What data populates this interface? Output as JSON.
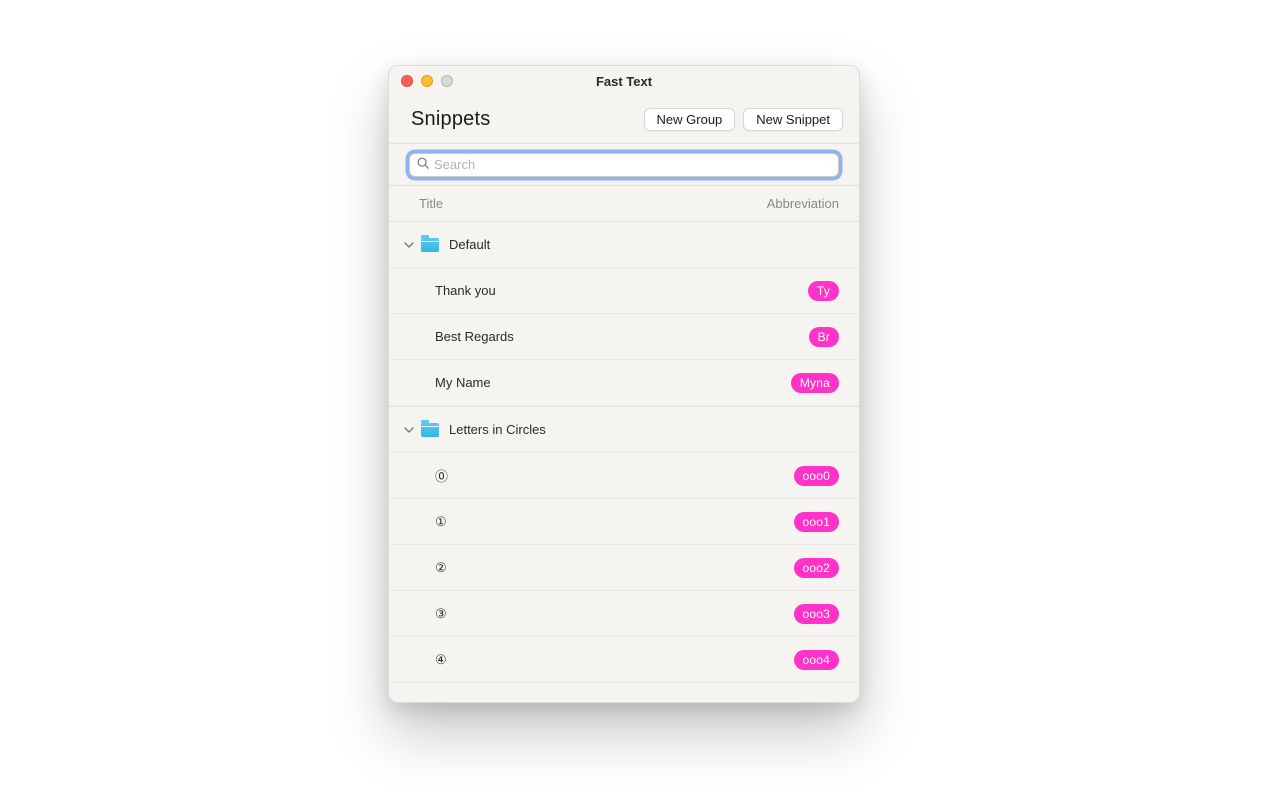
{
  "window": {
    "title": "Fast Text"
  },
  "toolbar": {
    "heading": "Snippets",
    "new_group_label": "New Group",
    "new_snippet_label": "New Snippet"
  },
  "search": {
    "placeholder": "Search"
  },
  "columns": {
    "title": "Title",
    "abbreviation": "Abbreviation"
  },
  "groups": [
    {
      "name": "Default",
      "items": [
        {
          "title": "Thank you",
          "abbr": "Ty"
        },
        {
          "title": "Best Regards",
          "abbr": "Br"
        },
        {
          "title": "My Name",
          "abbr": "Myna"
        }
      ]
    },
    {
      "name": "Letters in Circles",
      "items": [
        {
          "title": "⓪",
          "abbr": "ooo0"
        },
        {
          "title": "①",
          "abbr": "ooo1"
        },
        {
          "title": "②",
          "abbr": "ooo2"
        },
        {
          "title": "③",
          "abbr": "ooo3"
        },
        {
          "title": "④",
          "abbr": "ooo4"
        }
      ]
    }
  ],
  "colors": {
    "accent": "#ff33c7",
    "focus_ring": "#3e7de7"
  }
}
